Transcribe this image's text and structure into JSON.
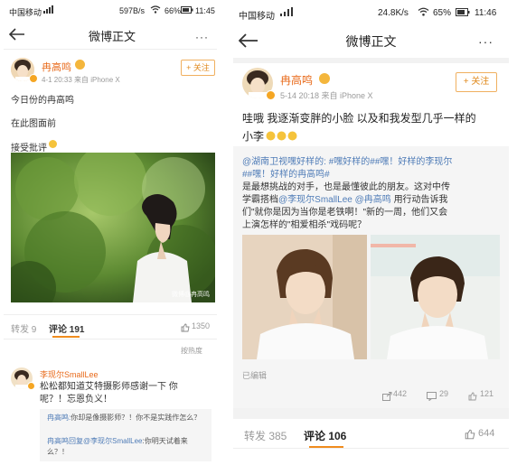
{
  "left": {
    "status": {
      "carrier": "中国移动",
      "speed": "597B/s",
      "battery": "66%",
      "time": "11:45"
    },
    "nav": {
      "title": "微博正文"
    },
    "post": {
      "username": "冉高鸣",
      "meta": "4-1 20:33  来自 iPhone X",
      "follow": "+ 关注",
      "lines": [
        "今日份的冉高鸣",
        "在此图面前",
        "接受批评"
      ],
      "photo_watermark": "微博@冉高鸣"
    },
    "tabs": {
      "repost": "转发 9",
      "comment": "评论 191",
      "like": "1350"
    },
    "sort_label": "按热度",
    "comment": {
      "username": "李现尔SmallLee",
      "text": "松松都知道艾特摄影师感谢一下 你呢？！忘恩负义！",
      "replies": [
        {
          "name": "冉高鸣:",
          "text": "你却是像摄影师？！你不是实践作怎么？"
        },
        {
          "name": "冉高鸣回复",
          "mention": "@李现尔SmallLee",
          "text": ":你明天试着来么？！"
        }
      ]
    }
  },
  "right": {
    "status": {
      "carrier": "中国移动",
      "speed": "24.8K/s",
      "battery": "65%",
      "time": "11:46"
    },
    "nav": {
      "title": "微博正文"
    },
    "post": {
      "username": "冉高鸣",
      "meta": "5-14 20:18  来自 iPhone X",
      "follow": "关注",
      "text_line1": "哇哦 我逐渐变胖的小脸 以及和我发型几乎一样的",
      "text_line2": "小李"
    },
    "repost": {
      "line1": "@湖南卫视嘿好样的: #嘿好样的##嘿！好样的李现尔",
      "line2": "##嘿！好样的冉高鸣#",
      "line3": "是最想挑战的对手，也是最懂彼此的朋友。这对中传",
      "line4_pre": "学霸搭档",
      "line4_mention1": "@李现尔SmallLee",
      "line4_mention2": "@冉高鸣",
      "line4_post": "用行动告诉我",
      "line5": "们\"就你是因为当你是老铁啊！\"新的一周，他们又会",
      "line6": "上演怎样的\"相爱相杀\"戏码呢？",
      "edited": "已编辑",
      "stats": {
        "forward": "442",
        "comment": "29",
        "like": "121"
      }
    },
    "tabs": {
      "repost": "转发 385",
      "comment": "评论 106",
      "like": "644"
    }
  }
}
